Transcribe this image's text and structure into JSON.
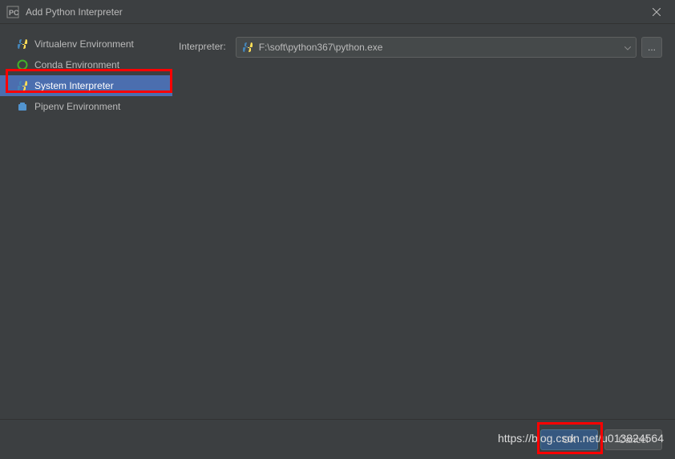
{
  "window": {
    "title": "Add Python Interpreter"
  },
  "sidebar": {
    "items": [
      {
        "label": "Virtualenv Environment"
      },
      {
        "label": "Conda Environment"
      },
      {
        "label": "System Interpreter"
      },
      {
        "label": "Pipenv Environment"
      }
    ]
  },
  "main": {
    "interpreter_label": "Interpreter:",
    "interpreter_value": "F:\\soft\\python367\\python.exe",
    "browse_label": "..."
  },
  "footer": {
    "ok_label": "OK",
    "cancel_label": "Cancel"
  },
  "watermark": "https://blog.csdn.net/u013824564"
}
